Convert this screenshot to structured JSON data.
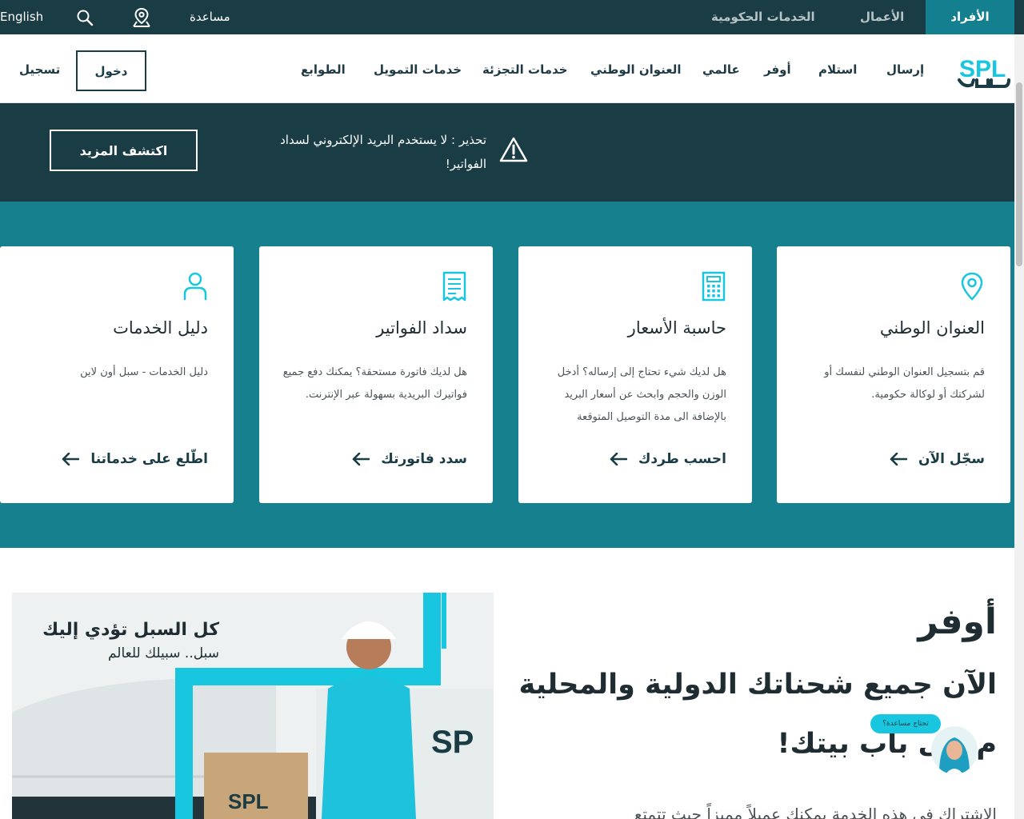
{
  "topbar": {
    "tabs": [
      {
        "label": "الأفراد"
      },
      {
        "label": "الأعمال"
      },
      {
        "label": "الخدمات الحكومية"
      }
    ],
    "help_label": "مساعدة",
    "language_label": "English"
  },
  "nav": {
    "items": [
      {
        "label": "إرسال"
      },
      {
        "label": "استلام"
      },
      {
        "label": "أوفر"
      },
      {
        "label": "عالمي"
      },
      {
        "label": "العنوان الوطني"
      },
      {
        "label": "خدمات التجزئة"
      },
      {
        "label": "خدمات التمويل"
      },
      {
        "label": "الطوابع"
      }
    ],
    "login_label": "دخول",
    "register_label": "تسجيل"
  },
  "warning": {
    "text": "تحذير : لا يستخدم البريد الإلكتروني لسداد الفواتير!",
    "button_label": "اكتشف المزيد"
  },
  "cards": [
    {
      "icon": "location-pin-icon",
      "title": "العنوان الوطني",
      "description": "قم بتسجيل العنوان الوطني لنفسك أو لشركتك أو لوكالة حكومية.",
      "link_label": "سجّل الآن"
    },
    {
      "icon": "calculator-icon",
      "title": "حاسبة الأسعار",
      "description": "هل لديك شيء تحتاج إلى إرساله؟ أدخل الوزن والحجم وابحث عن أسعار البريد بالإضافة الى مدة التوصيل المتوقعة",
      "link_label": "احسب طردك"
    },
    {
      "icon": "receipt-icon",
      "title": "سداد الفواتير",
      "description": "هل لديك فاتورة مستحقة؟ يمكنك دفع جميع فواتيرك البريدية بسهولة عبر الإنترنت.",
      "link_label": "سدد فاتورتك"
    },
    {
      "icon": "person-icon",
      "title": "دليل الخدمات",
      "description": "دليل الخدمات - سبل أون لاين",
      "link_label": "اطّلع على خدماتنا"
    }
  ],
  "promo": {
    "image_headline": "كل السبل تؤدي إليك",
    "image_tagline": "سبل.. سبيلك للعالم",
    "title": "أوفر",
    "subtitle_line1": "الآن جميع شحناتك الدولية والمحلية",
    "subtitle_line2": "م إلى باب بيتك!",
    "body": "الاشتراك في هذه الخدمة يمكنك عميلاً مميزاً حيث تتمتع",
    "help_bubble": "تحتاج مساعدة؟"
  },
  "colors": {
    "dark_teal": "#1a3c45",
    "teal": "#16808f",
    "accent_cyan": "#19c6e0"
  }
}
